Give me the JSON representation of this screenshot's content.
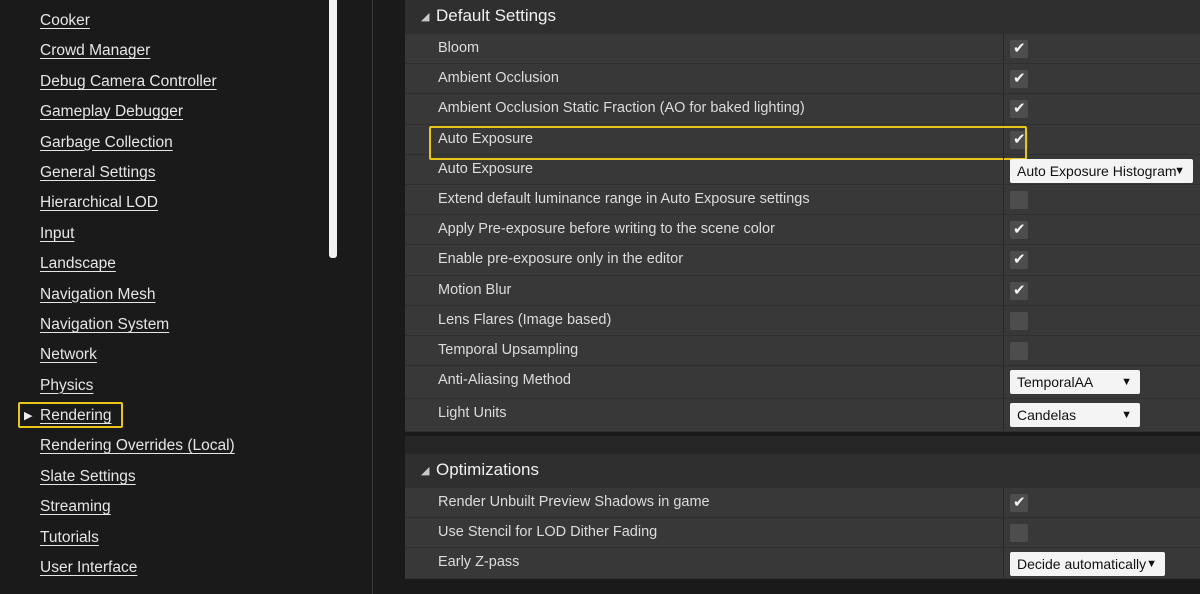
{
  "nav": {
    "items": [
      {
        "label": "Cooker"
      },
      {
        "label": "Crowd Manager"
      },
      {
        "label": "Debug Camera Controller"
      },
      {
        "label": "Gameplay Debugger"
      },
      {
        "label": "Garbage Collection"
      },
      {
        "label": "General Settings"
      },
      {
        "label": "Hierarchical LOD"
      },
      {
        "label": "Input"
      },
      {
        "label": "Landscape"
      },
      {
        "label": "Navigation Mesh"
      },
      {
        "label": "Navigation System"
      },
      {
        "label": "Network"
      },
      {
        "label": "Physics"
      },
      {
        "label": "Rendering",
        "selected": true
      },
      {
        "label": "Rendering Overrides (Local)"
      },
      {
        "label": "Slate Settings"
      },
      {
        "label": "Streaming"
      },
      {
        "label": "Tutorials"
      },
      {
        "label": "User Interface"
      }
    ]
  },
  "sections": {
    "default": {
      "title": "Default Settings",
      "rows": [
        {
          "label": "Bloom",
          "type": "checkbox",
          "checked": true
        },
        {
          "label": "Ambient Occlusion",
          "type": "checkbox",
          "checked": true
        },
        {
          "label": "Ambient Occlusion Static Fraction (AO for baked lighting)",
          "type": "checkbox",
          "checked": true
        },
        {
          "label": "Auto Exposure",
          "type": "checkbox",
          "checked": true,
          "highlight": true
        },
        {
          "label": "Auto Exposure",
          "type": "dropdown",
          "value": "Auto Exposure Histogram"
        },
        {
          "label": "Extend default luminance range in Auto Exposure settings",
          "type": "checkbox",
          "checked": false
        },
        {
          "label": "Apply Pre-exposure before writing to the scene color",
          "type": "checkbox",
          "checked": true
        },
        {
          "label": "Enable pre-exposure only in the editor",
          "type": "checkbox",
          "checked": true
        },
        {
          "label": "Motion Blur",
          "type": "checkbox",
          "checked": true
        },
        {
          "label": "Lens Flares (Image based)",
          "type": "checkbox",
          "checked": false
        },
        {
          "label": "Temporal Upsampling",
          "type": "checkbox",
          "checked": false
        },
        {
          "label": "Anti-Aliasing Method",
          "type": "dropdown",
          "value": "TemporalAA"
        },
        {
          "label": "Light Units",
          "type": "dropdown",
          "value": "Candelas"
        }
      ]
    },
    "optimizations": {
      "title": "Optimizations",
      "rows": [
        {
          "label": "Render Unbuilt Preview Shadows in game",
          "type": "checkbox",
          "checked": true
        },
        {
          "label": "Use Stencil for LOD Dither Fading",
          "type": "checkbox",
          "checked": false
        },
        {
          "label": "Early Z-pass",
          "type": "dropdown",
          "value": "Decide automatically"
        }
      ]
    }
  },
  "colors": {
    "highlight": "#e8c617",
    "header_bg": "#2f2f2f",
    "row_bg": "#383838",
    "panel_bg": "#1a1a1a"
  }
}
